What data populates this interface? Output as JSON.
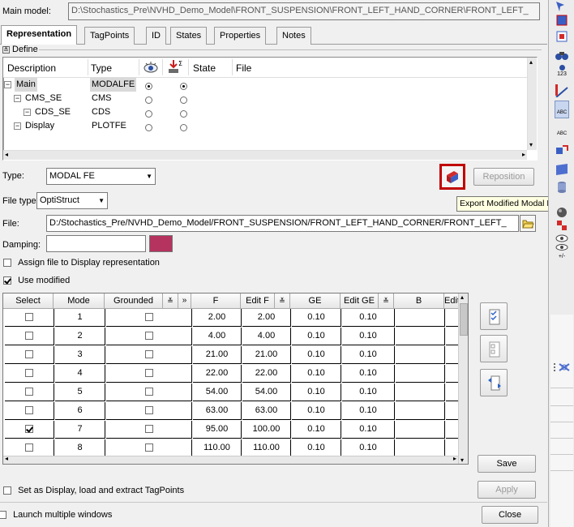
{
  "main_model": {
    "label": "Main model:",
    "value": "D:\\Stochastics_Pre\\NVHD_Demo_Model\\FRONT_SUSPENSION\\FRONT_LEFT_HAND_CORNER\\FRONT_LEFT_"
  },
  "tabs": [
    "Representation",
    "TagPoints",
    "ID",
    "States",
    "Properties",
    "Notes"
  ],
  "define_label": "Define",
  "tree": {
    "headers": [
      "Description",
      "Type",
      "State",
      "File"
    ],
    "rows": [
      {
        "description": "Main",
        "type": "MODALFE",
        "display": true,
        "export": true
      },
      {
        "description": "CMS_SE",
        "type": "CMS",
        "display": false,
        "export": false
      },
      {
        "description": "CDS_SE",
        "type": "CDS",
        "display": false,
        "export": false
      },
      {
        "description": "Display",
        "type": "PLOTFE",
        "display": false,
        "export": false
      }
    ]
  },
  "type_field": {
    "label": "Type:",
    "value": "MODAL FE"
  },
  "file_type_field": {
    "label": "File type:",
    "value": "OptiStruct"
  },
  "file_field": {
    "label": "File:",
    "value": "D:/Stochastics_Pre/NVHD_Demo_Model/FRONT_SUSPENSION/FRONT_LEFT_HAND_CORNER/FRONT_LEFT_"
  },
  "damping_field": {
    "label": "Damping:",
    "value": "",
    "color": "#b5335f"
  },
  "assign_file_label": "Assign file to Display representation",
  "use_modified_label": "Use modified",
  "reposition_label": "Reposition",
  "tooltip_text": "Export Modified Modal File",
  "grid": {
    "headers": [
      "Select",
      "Mode",
      "Grounded",
      "F",
      "Edit F",
      "GE",
      "Edit GE",
      "B",
      "Edit B"
    ],
    "rows": [
      {
        "select": false,
        "mode": "1",
        "grounded": false,
        "f": "2.00",
        "edit_f": "2.00",
        "ge": "0.10",
        "edit_ge": "0.10"
      },
      {
        "select": false,
        "mode": "2",
        "grounded": false,
        "f": "4.00",
        "edit_f": "4.00",
        "ge": "0.10",
        "edit_ge": "0.10"
      },
      {
        "select": false,
        "mode": "3",
        "grounded": false,
        "f": "21.00",
        "edit_f": "21.00",
        "ge": "0.10",
        "edit_ge": "0.10"
      },
      {
        "select": false,
        "mode": "4",
        "grounded": false,
        "f": "22.00",
        "edit_f": "22.00",
        "ge": "0.10",
        "edit_ge": "0.10"
      },
      {
        "select": false,
        "mode": "5",
        "grounded": false,
        "f": "54.00",
        "edit_f": "54.00",
        "ge": "0.10",
        "edit_ge": "0.10"
      },
      {
        "select": false,
        "mode": "6",
        "grounded": false,
        "f": "63.00",
        "edit_f": "63.00",
        "ge": "0.10",
        "edit_ge": "0.10"
      },
      {
        "select": true,
        "mode": "7",
        "grounded": false,
        "f": "95.00",
        "edit_f": "100.00",
        "ge": "0.10",
        "edit_ge": "0.10"
      },
      {
        "select": false,
        "mode": "8",
        "grounded": false,
        "f": "110.00",
        "edit_f": "110.00",
        "ge": "0.10",
        "edit_ge": "0.10"
      }
    ]
  },
  "save_label": "Save",
  "apply_label": "Apply",
  "set_display_label": "Set as Display, load and extract TagPoints",
  "launch_label": "Launch multiple windows",
  "close_label": "Close",
  "toolbar_small_text": {
    "count": "123",
    "abc1": "ABC",
    "abc2": "ABC",
    "plus_minus": "+/-"
  }
}
